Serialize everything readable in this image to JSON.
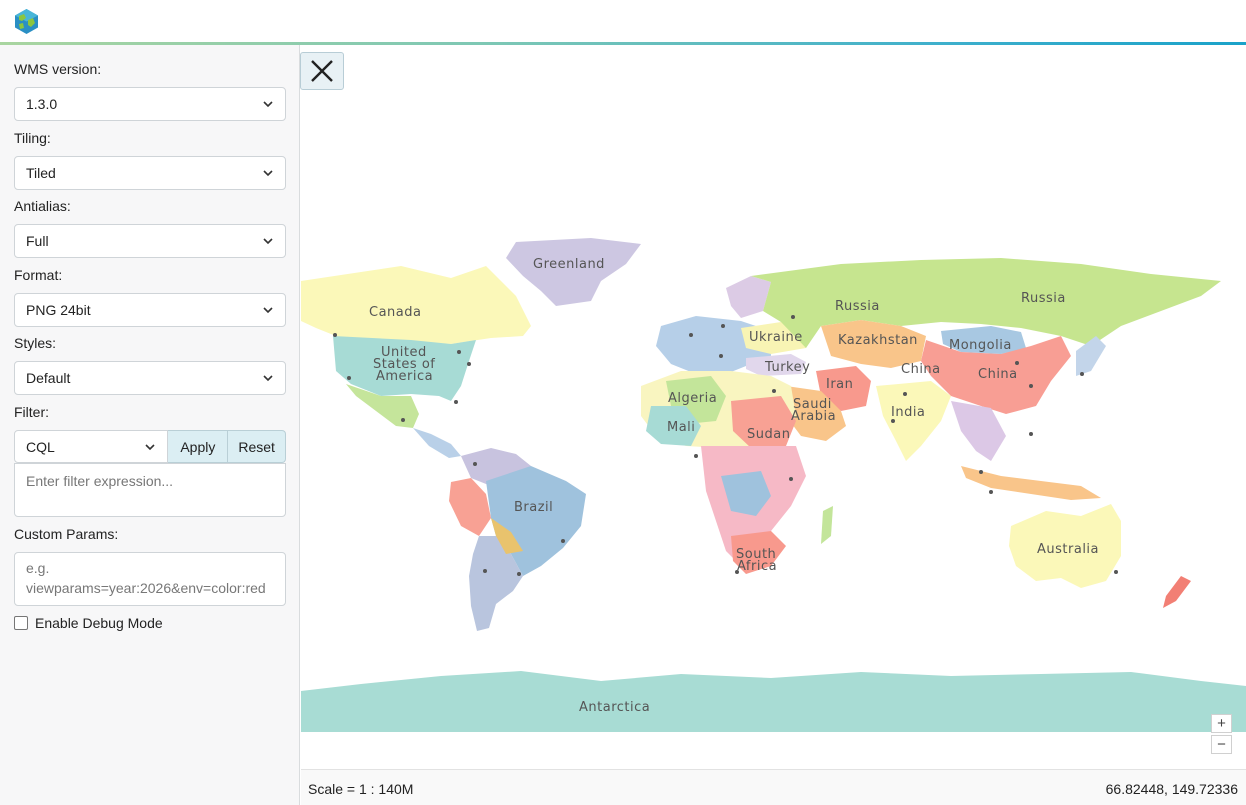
{
  "sidebar": {
    "wms_version": {
      "label": "WMS version:",
      "value": "1.3.0"
    },
    "tiling": {
      "label": "Tiling:",
      "value": "Tiled"
    },
    "antialias": {
      "label": "Antialias:",
      "value": "Full"
    },
    "format": {
      "label": "Format:",
      "value": "PNG 24bit"
    },
    "styles": {
      "label": "Styles:",
      "value": "Default"
    },
    "filter": {
      "label": "Filter:",
      "type": "CQL",
      "apply_label": "Apply",
      "reset_label": "Reset",
      "placeholder": "Enter filter expression..."
    },
    "custom_params": {
      "label": "Custom Params:",
      "placeholder": "e.g. viewparams=year:2026&env=color:red"
    },
    "debug": {
      "label": "Enable Debug Mode",
      "checked": false
    }
  },
  "map": {
    "labels": [
      "Greenland",
      "Canada",
      "United",
      "States of",
      "America",
      "Russia",
      "Russia",
      "Ukraine",
      "Kazakhstan",
      "Mongolia",
      "Turkey",
      "China",
      "China",
      "Iran",
      "Algeria",
      "Saudi",
      "Arabia",
      "India",
      "Mali",
      "Sudan",
      "Brazil",
      "South",
      "Africa",
      "Australia",
      "Antarctica"
    ],
    "zoom_in": "+",
    "zoom_out": "−"
  },
  "status": {
    "scale": "Scale = 1 : 140M",
    "coords": "66.82448, 149.72336"
  }
}
